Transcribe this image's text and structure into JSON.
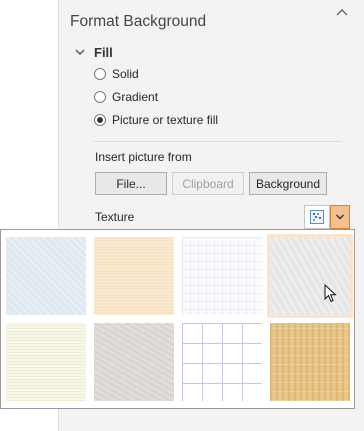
{
  "pane": {
    "title": "Format Background"
  },
  "fill": {
    "section_label": "Fill",
    "options": [
      {
        "label": "Solid",
        "checked": false
      },
      {
        "label": "Gradient",
        "checked": false
      },
      {
        "label": "Picture or texture fill",
        "checked": true
      }
    ]
  },
  "insert_picture": {
    "label": "Insert picture from",
    "buttons": {
      "file": "File...",
      "clipboard": "Clipboard",
      "background": "Background"
    }
  },
  "texture": {
    "label": "Texture",
    "tiles": [
      "blue-tissue-texture",
      "parchment-texture",
      "graph-paper-texture",
      "gray-stationery-texture",
      "cream-linen-texture",
      "recycled-paper-texture",
      "grid-texture",
      "oak-wood-texture"
    ],
    "hovered_tile": "gray-stationery-texture"
  },
  "colors": {
    "accent_dropdown": "#f5c08e",
    "accent_border": "#d4823a"
  }
}
